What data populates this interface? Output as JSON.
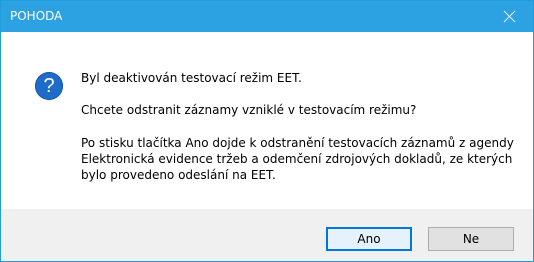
{
  "window": {
    "title": "POHODA",
    "close_icon": "close-icon"
  },
  "message": {
    "icon": "question-icon",
    "icon_glyph": "?",
    "line1": "Byl deaktivován testovací režim EET.",
    "line2": "Chcete odstranit záznamy vzniklé v testovacím režimu?",
    "paragraph_lines": [
      "Po stisku tlačítka Ano dojde k odstranění testovacích záznamů z agendy",
      "Elektronická evidence tržeb a odemčení zdrojových dokladů, ze kterých",
      "bylo provedeno odeslání na EET."
    ]
  },
  "buttons": {
    "yes": "Ano",
    "no": "Ne"
  },
  "colors": {
    "titlebar": "#2da2e3",
    "icon": "#1e6cc9",
    "footer": "#f0f0f0"
  }
}
